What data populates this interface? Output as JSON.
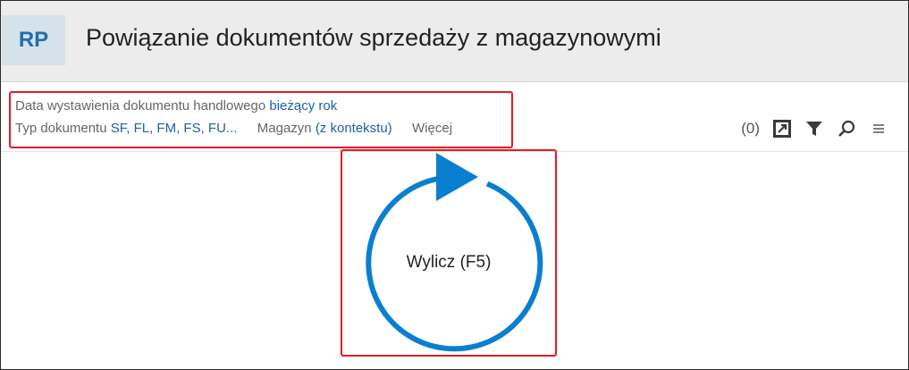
{
  "header": {
    "badge": "RP",
    "title": "Powiązanie dokumentów sprzedaży z magazynowymi"
  },
  "filters": {
    "date_label": "Data wystawienia dokumentu handlowego",
    "date_value": "bieżący rok",
    "doctype_label": "Typ dokumentu",
    "doctype_value": "SF, FL, FM, FS, FU...",
    "warehouse_label": "Magazyn",
    "warehouse_value": "(z kontekstu)",
    "more_label": "Więcej"
  },
  "toolbar": {
    "count": "(0)",
    "icons": [
      "export-icon",
      "filter-icon",
      "search-icon",
      "menu-icon"
    ]
  },
  "calc": {
    "label": "Wylicz (F5)"
  },
  "colors": {
    "accent": "#0a7fd0",
    "link": "#1f5fa8",
    "highlight": "#e21b23"
  }
}
